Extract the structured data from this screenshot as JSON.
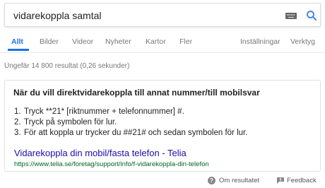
{
  "search": {
    "query": "vidarekoppla samtal"
  },
  "tabs": [
    {
      "label": "Allt"
    },
    {
      "label": "Bilder"
    },
    {
      "label": "Videor"
    },
    {
      "label": "Nyheter"
    },
    {
      "label": "Kartor"
    },
    {
      "label": "Fler"
    },
    {
      "label": "Inställningar"
    },
    {
      "label": "Verktyg"
    }
  ],
  "result_stats": "Ungefär 14 800 resultat (0,26 sekunder)",
  "featured_snippet": {
    "heading": "När du vill direktvidarekoppla till annat nummer/till mobilsvar",
    "steps": [
      {
        "num": "1.",
        "text": "Tryck **21* [riktnummer + telefonnummer] #."
      },
      {
        "num": "2.",
        "text": "Tryck på symbolen för lur."
      },
      {
        "num": "3.",
        "text": "För att koppla ur trycker du ##21# och sedan symbolen för lur."
      }
    ],
    "link_title": "Vidarekoppla din mobil/fasta telefon - Telia",
    "link_url": "https://www.telia.se/foretag/support/info/f-vidarekoppla-din-telefon"
  },
  "footer": {
    "help_icon_glyph": "?",
    "about_label": "Om resultatet",
    "feedback_label": "Feedback"
  },
  "colors": {
    "accent": "#1a73e8",
    "link": "#1a0dab",
    "url": "#006621"
  }
}
